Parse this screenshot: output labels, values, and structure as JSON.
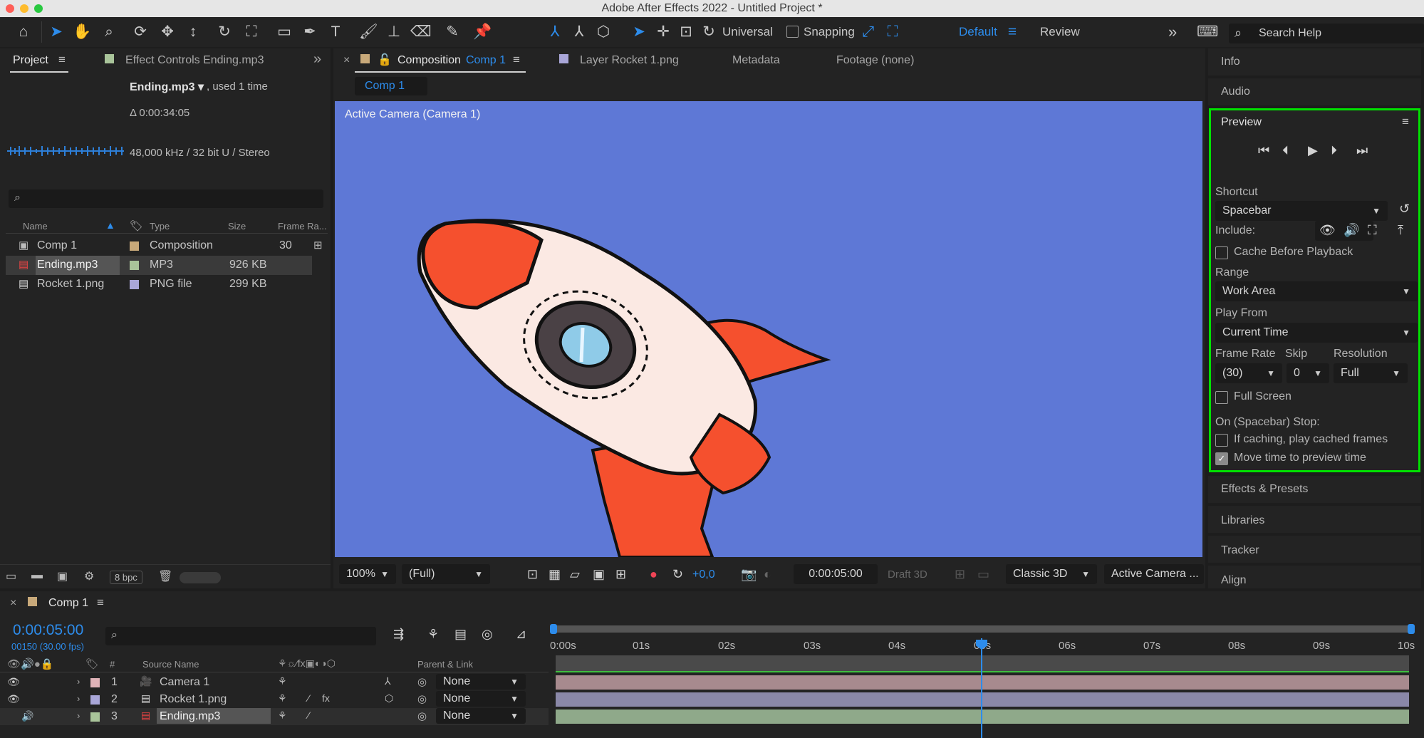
{
  "window": {
    "title": "Adobe After Effects 2022 - Untitled Project *"
  },
  "toolbar": {
    "universal_label": "Universal",
    "snapping_label": "Snapping",
    "workspace_default": "Default",
    "workspace_review": "Review",
    "search_placeholder": "Search Help",
    "overflow": "»"
  },
  "project_panel": {
    "tab_project": "Project",
    "tab_effect_controls": "Effect Controls Ending.mp3",
    "selected_name": "Ending.mp3 ▾",
    "used_text": ", used 1 time",
    "duration": "Δ 0:00:34:05",
    "audio_info": "48,000 kHz / 32 bit U / Stereo",
    "columns": {
      "name": "Name",
      "type": "Type",
      "size": "Size",
      "frame_rate": "Frame Ra..."
    },
    "items": [
      {
        "name": "Comp 1",
        "type": "Composition",
        "size": "",
        "frame_rate": "30",
        "swatch": "#c8a97a"
      },
      {
        "name": "Ending.mp3",
        "type": "MP3",
        "size": "926 KB",
        "frame_rate": "",
        "swatch": "#a9c49a"
      },
      {
        "name": "Rocket 1.png",
        "type": "PNG file",
        "size": "299 KB",
        "frame_rate": "",
        "swatch": "#a9a6d8"
      }
    ],
    "bpc": "8 bpc"
  },
  "comp_panel": {
    "tab_close": "×",
    "tab_composition_prefix": "Composition",
    "tab_composition_name": "Comp 1",
    "tab_layer": "Layer Rocket 1.png",
    "tab_metadata": "Metadata",
    "tab_footage": "Footage (none)",
    "breadcrumb": "Comp 1",
    "camera_label": "Active Camera (Camera 1)",
    "zoom": "100%",
    "resolution": "(Full)",
    "exposure": "+0,0",
    "timecode": "0:00:05:00",
    "draft3d": "Draft 3D",
    "renderer": "Classic 3D",
    "view": "Active Camera ..."
  },
  "right_panel": {
    "info": "Info",
    "audio": "Audio",
    "preview_title": "Preview",
    "shortcut_label": "Shortcut",
    "shortcut_value": "Spacebar",
    "include_label": "Include:",
    "cache_label": "Cache Before Playback",
    "range_label": "Range",
    "range_value": "Work Area",
    "playfrom_label": "Play From",
    "playfrom_value": "Current Time",
    "framerate_label": "Frame Rate",
    "framerate_value": "(30)",
    "skip_label": "Skip",
    "skip_value": "0",
    "resolution_label": "Resolution",
    "resolution_value": "Full",
    "fullscreen_label": "Full Screen",
    "onstop_label": "On (Spacebar) Stop:",
    "ifcaching_label": "If caching, play cached frames",
    "movetime_label": "Move time to preview time",
    "effects": "Effects & Presets",
    "libraries": "Libraries",
    "tracker": "Tracker",
    "align": "Align",
    "highlight_color": "#00e000"
  },
  "timeline": {
    "tab_close": "×",
    "tab_name": "Comp 1",
    "timecode": "0:00:05:00",
    "frames": "00150 (30.00 fps)",
    "col_num": "#",
    "col_source": "Source Name",
    "col_parent": "Parent & Link",
    "ruler": [
      "0:00s",
      "01s",
      "02s",
      "03s",
      "04s",
      "05s",
      "06s",
      "07s",
      "08s",
      "09s",
      "10s"
    ],
    "layers": [
      {
        "num": "1",
        "name": "Camera 1",
        "parent": "None",
        "swatch": "#e0b3b8",
        "bar": "#a78a8e"
      },
      {
        "num": "2",
        "name": "Rocket 1.png",
        "parent": "None",
        "swatch": "#a9a6d8",
        "bar": "#8a88a8"
      },
      {
        "num": "3",
        "name": "Ending.mp3",
        "parent": "None",
        "swatch": "#a9c49a",
        "bar": "#8fa98a"
      }
    ]
  }
}
